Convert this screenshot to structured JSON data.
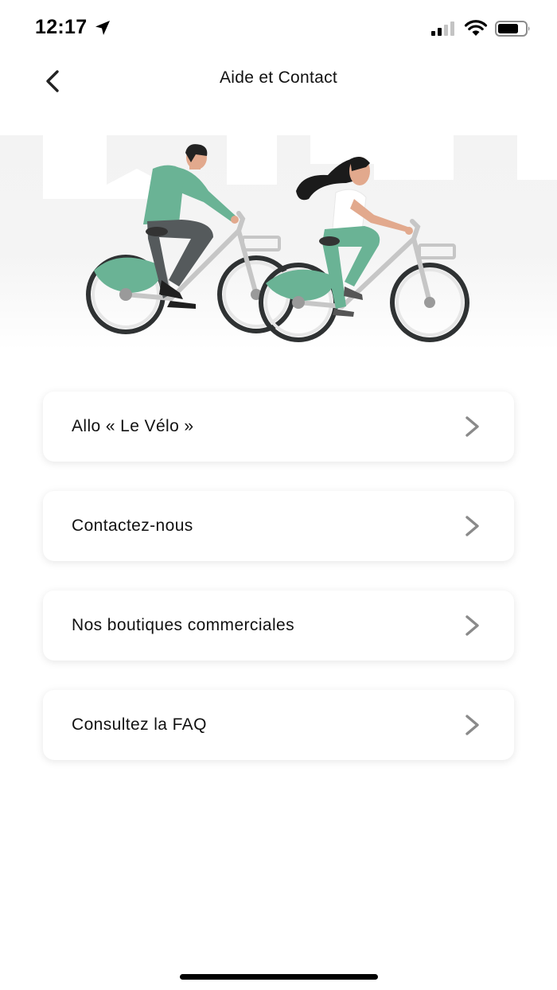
{
  "status_bar": {
    "time": "12:17",
    "icons": [
      "location-arrow-icon",
      "cellular-signal-icon",
      "wifi-icon",
      "battery-icon"
    ]
  },
  "header": {
    "title": "Aide et Contact",
    "back_icon": "chevron-left-icon"
  },
  "hero": {
    "illustration": "two-cyclists-on-shared-bikes",
    "accent_color": "#6ab395"
  },
  "menu": {
    "items": [
      {
        "label": "Allo « Le Vélo »",
        "icon": "chevron-right-icon"
      },
      {
        "label": "Contactez-nous",
        "icon": "chevron-right-icon"
      },
      {
        "label": "Nos boutiques commerciales",
        "icon": "chevron-right-icon"
      },
      {
        "label": "Consultez la FAQ",
        "icon": "chevron-right-icon"
      }
    ]
  },
  "colors": {
    "background": "#ffffff",
    "text": "#111111",
    "chevron": "#888888",
    "bike_frame": "#c8c8c8",
    "bike_accent": "#6ab395"
  }
}
